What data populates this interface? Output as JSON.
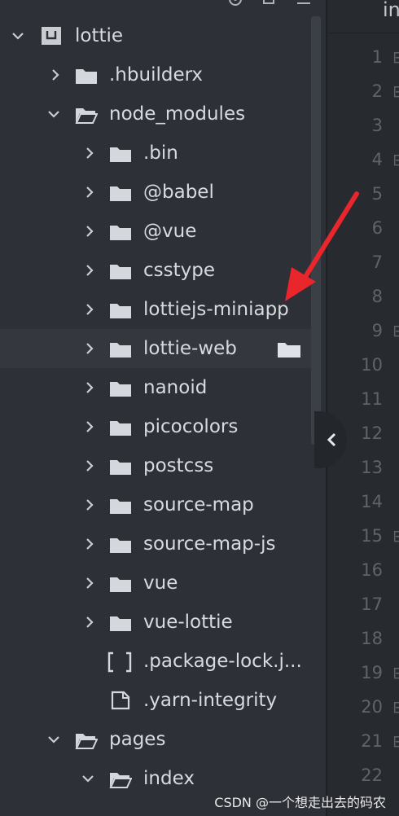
{
  "editor": {
    "tab_label": "in",
    "line_numbers": [
      "1",
      "2",
      "3",
      "4",
      "5",
      "6",
      "7",
      "8",
      "9",
      "10",
      "11",
      "12",
      "13",
      "14",
      "15",
      "16",
      "17",
      "18",
      "19",
      "20",
      "21",
      "22"
    ],
    "fold_marker": "⊟"
  },
  "tree": {
    "root": "lottie",
    "items": [
      {
        "label": ".hbuilderx"
      },
      {
        "label": "node_modules"
      },
      {
        "label": ".bin"
      },
      {
        "label": "@babel"
      },
      {
        "label": "@vue"
      },
      {
        "label": "csstype"
      },
      {
        "label": "lottiejs-miniapp"
      },
      {
        "label": "lottie-web"
      },
      {
        "label": "nanoid"
      },
      {
        "label": "picocolors"
      },
      {
        "label": "postcss"
      },
      {
        "label": "source-map"
      },
      {
        "label": "source-map-js"
      },
      {
        "label": "vue"
      },
      {
        "label": "vue-lottie"
      },
      {
        "label": ".package-lock.j..."
      },
      {
        "label": ".yarn-integrity"
      },
      {
        "label": "pages"
      },
      {
        "label": "index"
      }
    ]
  },
  "annotation": {
    "color": "#e8262b"
  },
  "watermark": "CSDN @一个想走出去的码农"
}
